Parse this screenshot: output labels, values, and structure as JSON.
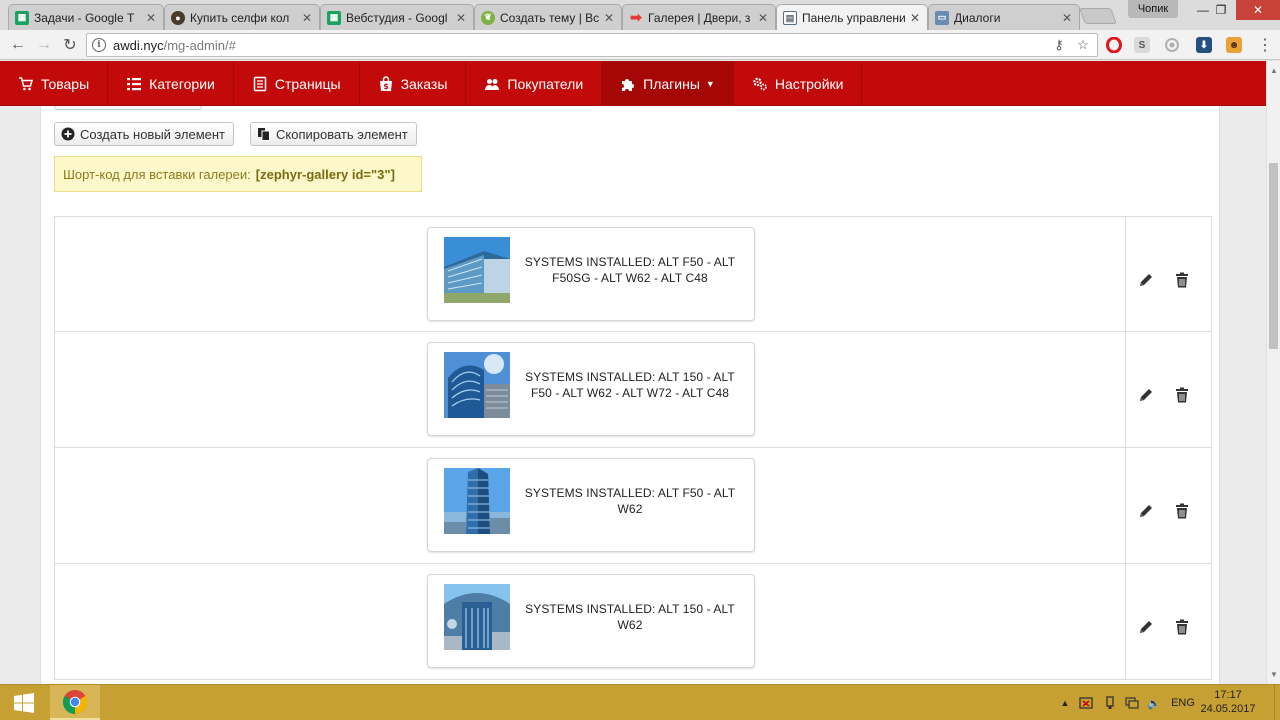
{
  "browser": {
    "tabs": [
      {
        "title": "Задачи - Google Т",
        "favicon_color": "#1aa260",
        "favicon_name": "sheets-icon"
      },
      {
        "title": "Купить селфи кол",
        "favicon_color": "#4a3b2a",
        "favicon_name": "shop-icon"
      },
      {
        "title": "Вебстудия - Googl",
        "favicon_color": "#1aa260",
        "favicon_name": "sheets-icon"
      },
      {
        "title": "Создать тему | Все",
        "favicon_color": "#7cb342",
        "favicon_name": "leaf-icon"
      },
      {
        "title": "Галерея | Двери, з",
        "favicon_color": "#e53935",
        "favicon_name": "arrow-icon"
      },
      {
        "title": "Панель управлени",
        "favicon_color": "#5a6b7a",
        "favicon_name": "panel-icon",
        "active": true
      },
      {
        "title": "Диалоги",
        "favicon_color": "#6a8caf",
        "favicon_name": "chat-icon"
      }
    ],
    "user_name": "Чопик",
    "url_host": "awdi.nyc",
    "url_path": "/mg-admin/#"
  },
  "admin_nav": {
    "items": [
      {
        "label": "Товары",
        "icon": "cart-icon"
      },
      {
        "label": "Категории",
        "icon": "list-icon"
      },
      {
        "label": "Страницы",
        "icon": "pages-icon"
      },
      {
        "label": "Заказы",
        "icon": "bag-icon"
      },
      {
        "label": "Покупатели",
        "icon": "users-icon"
      },
      {
        "label": "Плагины",
        "icon": "puzzle-icon",
        "active": true
      },
      {
        "label": "Настройки",
        "icon": "gear-icon"
      }
    ],
    "accent": "#c20a0a"
  },
  "toolbar": {
    "create_label": "Создать новый элемент",
    "copy_label": "Скопировать элемент"
  },
  "shortcode": {
    "label": "Шорт-код для вставки галереи:",
    "code": "[zephyr-gallery id=\"3\"]"
  },
  "gallery": {
    "items": [
      {
        "caption": "SYSTEMS INSTALLED: ALT F50 - ALT F50SG - ALT W62 - ALT C48"
      },
      {
        "caption": "SYSTEMS INSTALLED: ALT 150 - ALT F50 - ALT W62 - ALT W72 - ALT C48"
      },
      {
        "caption": "SYSTEMS INSTALLED: ALT F50 - ALT W62"
      },
      {
        "caption": "SYSTEMS INSTALLED: ALT 150 - ALT W62"
      }
    ]
  },
  "taskbar": {
    "language": "ENG",
    "time": "17:17",
    "date": "24.05.2017"
  }
}
